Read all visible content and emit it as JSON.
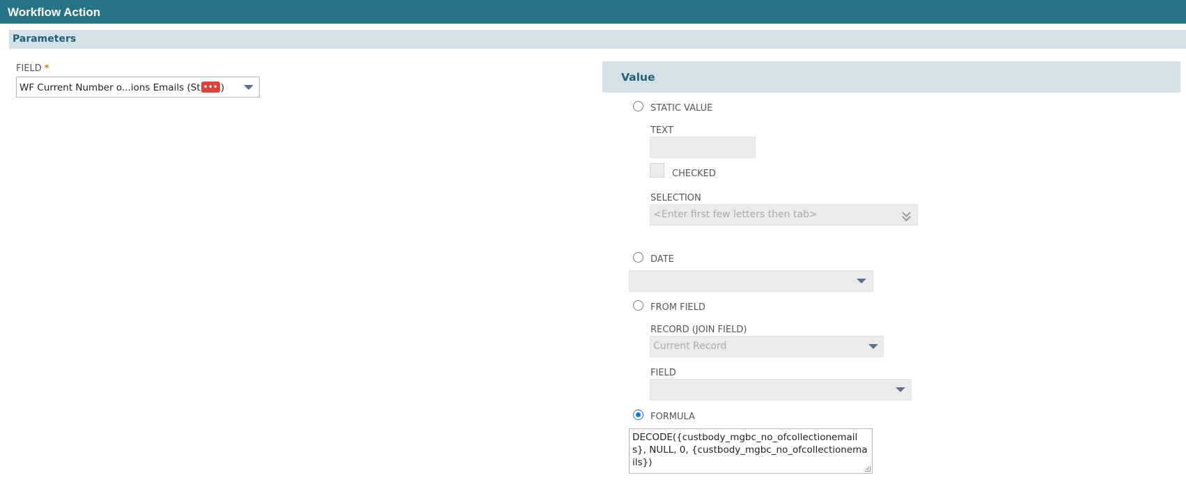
{
  "window": {
    "title": "Workflow Action"
  },
  "parameters": {
    "section_label": "Parameters",
    "field": {
      "label": "FIELD",
      "required_marker": "*",
      "value_prefix": "WF Current Number o...ions Emails (St",
      "redacted_mark": "•••",
      "value_suffix": ")"
    }
  },
  "value": {
    "panel_title": "Value",
    "options": {
      "static_value": "STATIC VALUE",
      "date": "DATE",
      "from_field": "FROM FIELD",
      "formula": "FORMULA"
    },
    "selected_option": "formula",
    "static": {
      "text_label": "TEXT",
      "text_value": "",
      "checked_label": "CHECKED",
      "selection_label": "SELECTION",
      "selection_placeholder": "<Enter first few letters then tab>"
    },
    "from_field": {
      "record_label": "RECORD (JOIN FIELD)",
      "record_value": "Current Record",
      "field_label": "FIELD",
      "field_value": ""
    },
    "formula_text": "DECODE({custbody_mgbc_no_ofcollectionemails}, NULL, 0, {custbody_mgbc_no_ofcollectionemails})"
  },
  "colors": {
    "header_bar": "#277487",
    "section_bar": "#d3e2e8",
    "section_text": "#24606f",
    "required": "#e07b10",
    "radio_selected": "#1e6fd9",
    "disabled_field": "#ebebeb"
  }
}
